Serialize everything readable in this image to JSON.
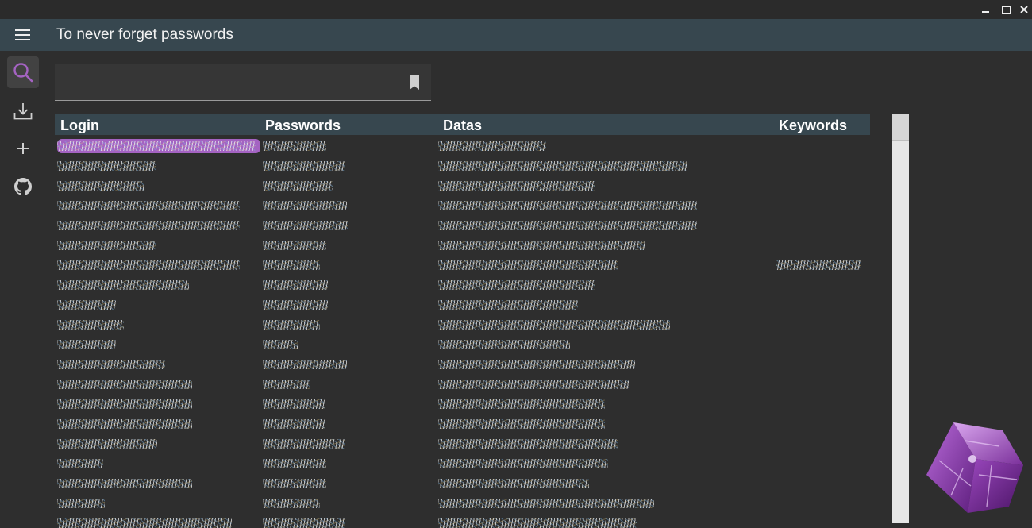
{
  "window": {
    "controls": [
      "minimize-icon",
      "maximize-icon",
      "close-icon"
    ]
  },
  "appbar": {
    "menu_icon": "hamburger-icon",
    "title": "To never forget passwords"
  },
  "rail": {
    "items": [
      {
        "icon": "search-icon",
        "active": true
      },
      {
        "icon": "download-icon",
        "active": false
      },
      {
        "icon": "plus-icon",
        "active": false
      },
      {
        "icon": "github-icon",
        "active": false
      }
    ],
    "accent": "#a463c2"
  },
  "search": {
    "value": "",
    "placeholder": "",
    "action_icon": "bookmark-icon"
  },
  "table": {
    "columns": [
      "Login",
      "Passwords",
      "Datas",
      "Keywords"
    ],
    "selected_row": 0,
    "rows": [
      {
        "login_w": 250,
        "pass_w": 80,
        "data_w": 136,
        "kw_w": 0
      },
      {
        "login_w": 124,
        "pass_w": 104,
        "data_w": 314,
        "kw_w": 0
      },
      {
        "login_w": 110,
        "pass_w": 88,
        "data_w": 198,
        "kw_w": 0
      },
      {
        "login_w": 230,
        "pass_w": 106,
        "data_w": 326,
        "kw_w": 0
      },
      {
        "login_w": 230,
        "pass_w": 108,
        "data_w": 326,
        "kw_w": 0
      },
      {
        "login_w": 124,
        "pass_w": 80,
        "data_w": 260,
        "kw_w": 0
      },
      {
        "login_w": 230,
        "pass_w": 72,
        "data_w": 226,
        "kw_w": 108
      },
      {
        "login_w": 166,
        "pass_w": 82,
        "data_w": 198,
        "kw_w": 0
      },
      {
        "login_w": 74,
        "pass_w": 82,
        "data_w": 176,
        "kw_w": 0
      },
      {
        "login_w": 84,
        "pass_w": 72,
        "data_w": 292,
        "kw_w": 0
      },
      {
        "login_w": 74,
        "pass_w": 44,
        "data_w": 166,
        "kw_w": 0
      },
      {
        "login_w": 136,
        "pass_w": 106,
        "data_w": 248,
        "kw_w": 0
      },
      {
        "login_w": 170,
        "pass_w": 60,
        "data_w": 240,
        "kw_w": 0
      },
      {
        "login_w": 170,
        "pass_w": 78,
        "data_w": 210,
        "kw_w": 0
      },
      {
        "login_w": 170,
        "pass_w": 78,
        "data_w": 210,
        "kw_w": 0
      },
      {
        "login_w": 126,
        "pass_w": 104,
        "data_w": 226,
        "kw_w": 0
      },
      {
        "login_w": 58,
        "pass_w": 80,
        "data_w": 214,
        "kw_w": 0
      },
      {
        "login_w": 170,
        "pass_w": 80,
        "data_w": 190,
        "kw_w": 0
      },
      {
        "login_w": 60,
        "pass_w": 72,
        "data_w": 272,
        "kw_w": 0
      },
      {
        "login_w": 220,
        "pass_w": 104,
        "data_w": 250,
        "kw_w": 0
      }
    ]
  },
  "scrollbar": {
    "position": 0
  }
}
